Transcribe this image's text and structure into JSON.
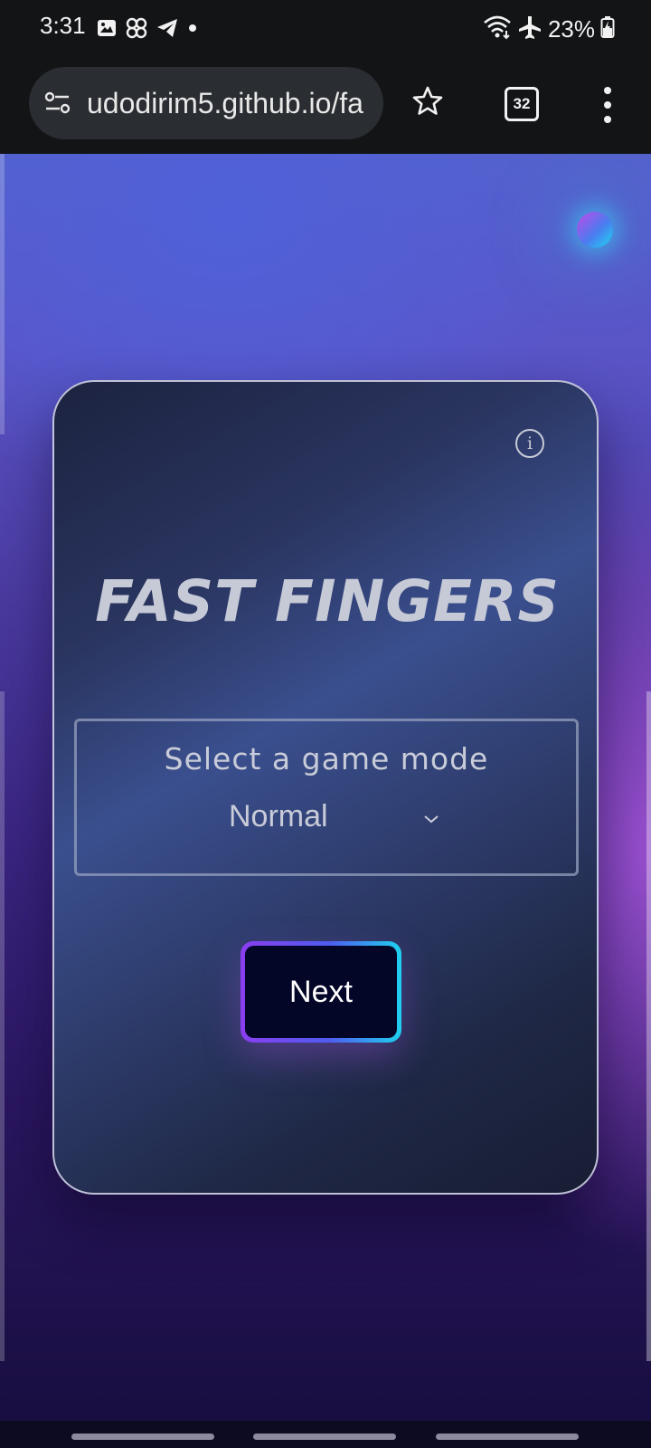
{
  "status_bar": {
    "time": "3:31",
    "left_icons": [
      "gallery-icon",
      "pinwheel-icon",
      "telegram-icon",
      "dot-icon"
    ],
    "right_icons": [
      "wifi-icon",
      "airplane-icon",
      "battery-charging-icon"
    ],
    "battery": "23%"
  },
  "browser": {
    "url": "udodirim5.github.io/fa",
    "tab_count": "32",
    "icons": [
      "site-settings-icon",
      "star-icon",
      "tabs-icon",
      "menu-icon"
    ]
  },
  "game": {
    "title": "FAST FINGERS",
    "info_glyph": "i",
    "mode_label": "Select a game mode",
    "selected_mode": "Normal",
    "next_label": "Next"
  },
  "colors": {
    "card_border": "#dcdcf0",
    "button_gradient": [
      "#8b3df0",
      "#4f5cf0",
      "#1ed0ee"
    ],
    "button_fill": "#040628",
    "orb_gradient": [
      "#c24ae8",
      "#4a7cf0",
      "#1ed8f0"
    ]
  }
}
